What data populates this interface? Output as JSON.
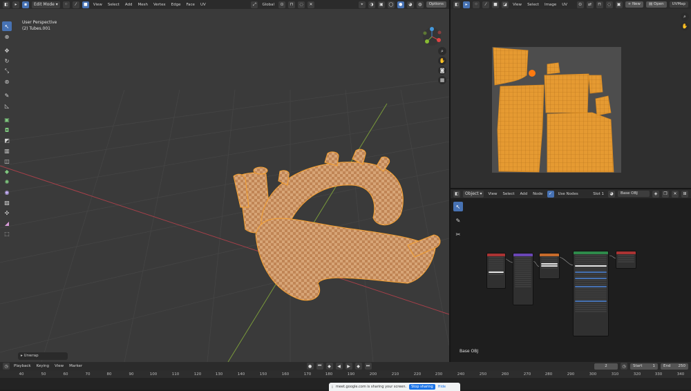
{
  "viewport3d": {
    "header": {
      "mode": "Edit Mode",
      "menus": [
        "View",
        "Select",
        "Add",
        "Mesh",
        "Vertex",
        "Edge",
        "Face",
        "UV"
      ],
      "transform_orientation": "Global",
      "options_label": "Options"
    },
    "overlay_text": {
      "view_name": "User Perspective",
      "object_name": "(2) Tubes.001"
    },
    "last_operator": "Unwrap"
  },
  "uv_editor": {
    "menus": [
      "View",
      "Select",
      "Image",
      "UV"
    ],
    "new_label": "New",
    "open_label": "Open",
    "uvmap_label": "UVMap"
  },
  "node_editor": {
    "object_selector": "Object",
    "menus": [
      "View",
      "Select",
      "Add",
      "Node"
    ],
    "use_nodes_label": "Use Nodes",
    "slot_label": "Slot 1",
    "material_name": "Base OBJ",
    "footer_material": "Base OBJ"
  },
  "timeline": {
    "menus": [
      "Playback",
      "Keying",
      "View",
      "Marker"
    ],
    "current_frame": "2",
    "start_label": "Start",
    "start_value": "1",
    "end_label": "End",
    "end_value": "250",
    "ruler_labels": [
      "40",
      "50",
      "60",
      "70",
      "80",
      "90",
      "100",
      "110",
      "120",
      "130",
      "140",
      "150",
      "160",
      "170",
      "180",
      "190",
      "200",
      "210",
      "220",
      "230",
      "240",
      "250",
      "260",
      "270",
      "280",
      "290",
      "300",
      "310",
      "320",
      "330",
      "340"
    ]
  },
  "notification": {
    "text": "meet.google.com is sharing your screen.",
    "stop_label": "Stop sharing",
    "hide_label": "Hide"
  },
  "colors": {
    "accent": "#4772b3",
    "selection_orange": "#f5a030",
    "mesh_fill": "#d9a06a",
    "x_axis": "#a8404a",
    "y_axis": "#7a9b3a"
  }
}
